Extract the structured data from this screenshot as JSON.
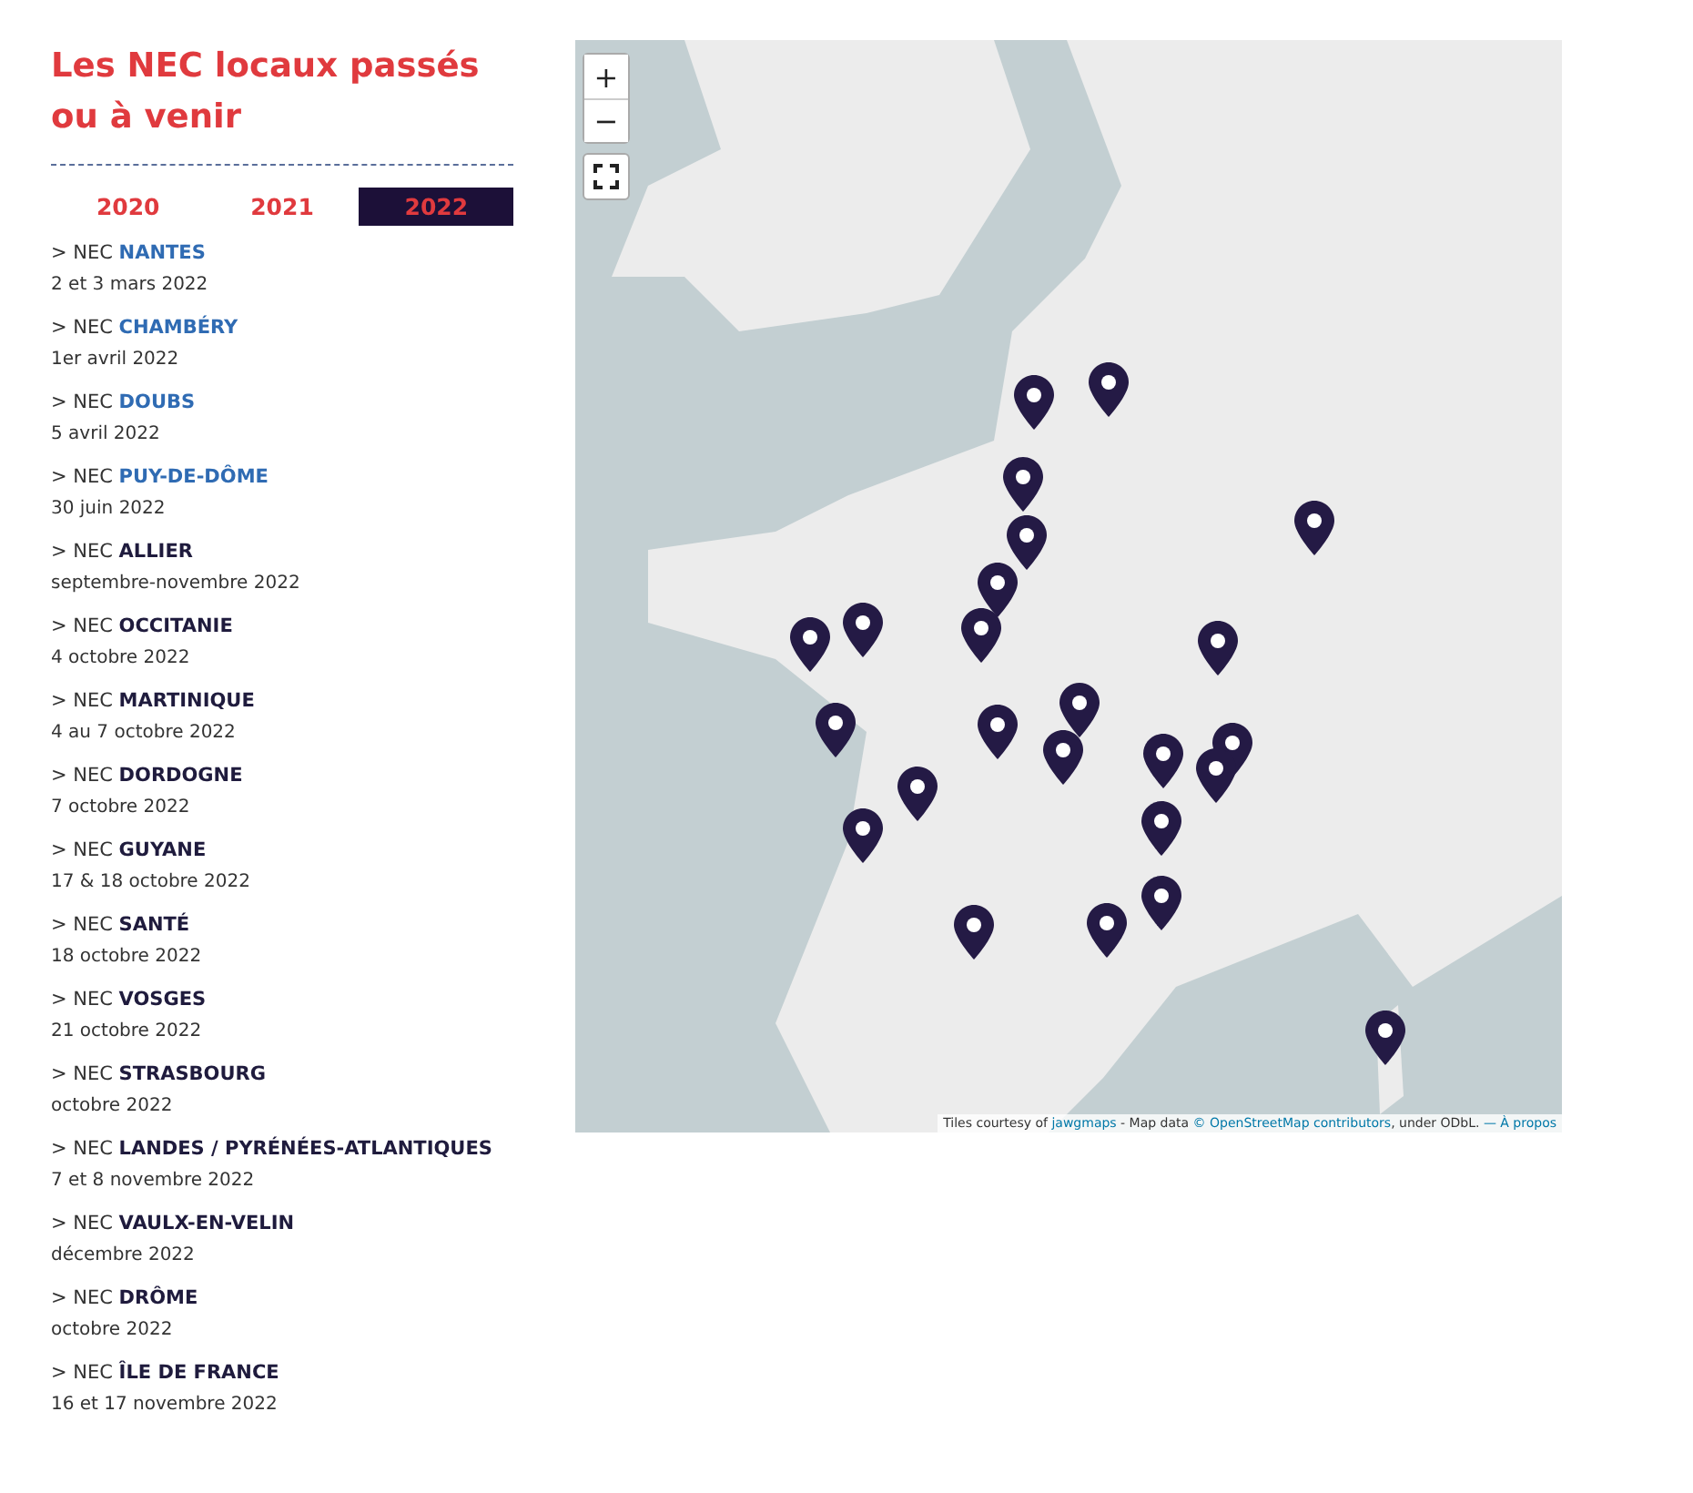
{
  "heading": "Les NEC locaux passés ou à venir",
  "year_tabs": [
    {
      "label": "2020",
      "selected": false
    },
    {
      "label": "2021",
      "selected": false
    },
    {
      "label": "2022",
      "selected": true
    }
  ],
  "events": [
    {
      "prefix": "> NEC",
      "name": "NANTES",
      "date": "2 et 3 mars 2022",
      "linked": true
    },
    {
      "prefix": "> NEC",
      "name": "CHAMBÉRY",
      "date": "1er avril 2022",
      "linked": true
    },
    {
      "prefix": "> NEC",
      "name": "DOUBS",
      "date": "5 avril 2022",
      "linked": true
    },
    {
      "prefix": "> NEC",
      "name": "PUY-DE-DÔME",
      "date": "30 juin 2022",
      "linked": true
    },
    {
      "prefix": "> NEC",
      "name": "ALLIER",
      "date": "septembre-novembre 2022",
      "linked": false
    },
    {
      "prefix": "> NEC",
      "name": "OCCITANIE",
      "date": "4 octobre 2022",
      "linked": false
    },
    {
      "prefix": "> NEC",
      "name": "MARTINIQUE",
      "date": "4 au 7 octobre 2022",
      "linked": false
    },
    {
      "prefix": "> NEC",
      "name": "DORDOGNE",
      "date": "7 octobre 2022",
      "linked": false
    },
    {
      "prefix": "> NEC",
      "name": "GUYANE",
      "date": "17 & 18 octobre 2022",
      "linked": false
    },
    {
      "prefix": "> NEC",
      "name": "SANTÉ",
      "date": "18 octobre 2022",
      "linked": false
    },
    {
      "prefix": "> NEC",
      "name": "VOSGES",
      "date": "21 octobre 2022",
      "linked": false
    },
    {
      "prefix": "> NEC",
      "name": "STRASBOURG",
      "date": "octobre 2022",
      "linked": false
    },
    {
      "prefix": "> NEC",
      "name": "LANDES / PYRÉNÉES-ATLANTIQUES",
      "date": "7 et 8 novembre 2022",
      "linked": false
    },
    {
      "prefix": "> NEC",
      "name": "VAULX-EN-VELIN",
      "date": "décembre 2022",
      "linked": false
    },
    {
      "prefix": "> NEC",
      "name": "DRÔME",
      "date": "octobre 2022",
      "linked": false
    },
    {
      "prefix": "> NEC",
      "name": "ÎLE DE FRANCE",
      "date": "16 et 17 novembre 2022",
      "linked": false
    }
  ],
  "map": {
    "zoom_in": "+",
    "zoom_out": "−",
    "attribution": [
      {
        "text": "Tiles courtesy of ",
        "link": false
      },
      {
        "text": "jawgmaps",
        "link": true
      },
      {
        "text": " - Map data ",
        "link": false
      },
      {
        "text": "© OpenStreetMap contributors",
        "link": true
      },
      {
        "text": ", under ODbL. ",
        "link": false
      },
      {
        "text": "— À propos",
        "link": true
      }
    ]
  }
}
